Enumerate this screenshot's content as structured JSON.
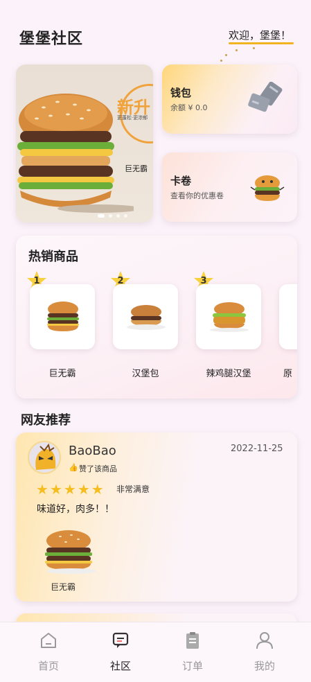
{
  "header": {
    "title": "堡堡社区",
    "welcome": "欢迎，堡堡！"
  },
  "banner": {
    "title": "新升",
    "subtitle": "更蓬松·更浓郁",
    "tag": "巨无霸"
  },
  "wallet": {
    "title": "钱包",
    "subtitle": "余额 ¥ 0.0"
  },
  "coupon": {
    "title": "卡卷",
    "subtitle": "查看你的优惠卷"
  },
  "hot": {
    "title": "热销商品",
    "items": [
      {
        "rank": "1",
        "name": "巨无霸"
      },
      {
        "rank": "2",
        "name": "汉堡包"
      },
      {
        "rank": "3",
        "name": "辣鸡腿汉堡"
      },
      {
        "rank": "",
        "name": "原"
      }
    ]
  },
  "recommend": {
    "title": "网友推荐",
    "user": "BaoBao",
    "liked": "赞了该商品",
    "date": "2022-11-25",
    "rating_label": "非常满意",
    "rating": 5,
    "review": "味道好，肉多！！",
    "product": "巨无霸"
  },
  "tabs": [
    {
      "label": "首页",
      "icon": "home-icon"
    },
    {
      "label": "社区",
      "icon": "community-icon"
    },
    {
      "label": "订单",
      "icon": "order-icon"
    },
    {
      "label": "我的",
      "icon": "profile-icon"
    }
  ],
  "colors": {
    "accent": "#f2b320",
    "star": "#f6bd1e",
    "background": "#fcf3fa"
  }
}
